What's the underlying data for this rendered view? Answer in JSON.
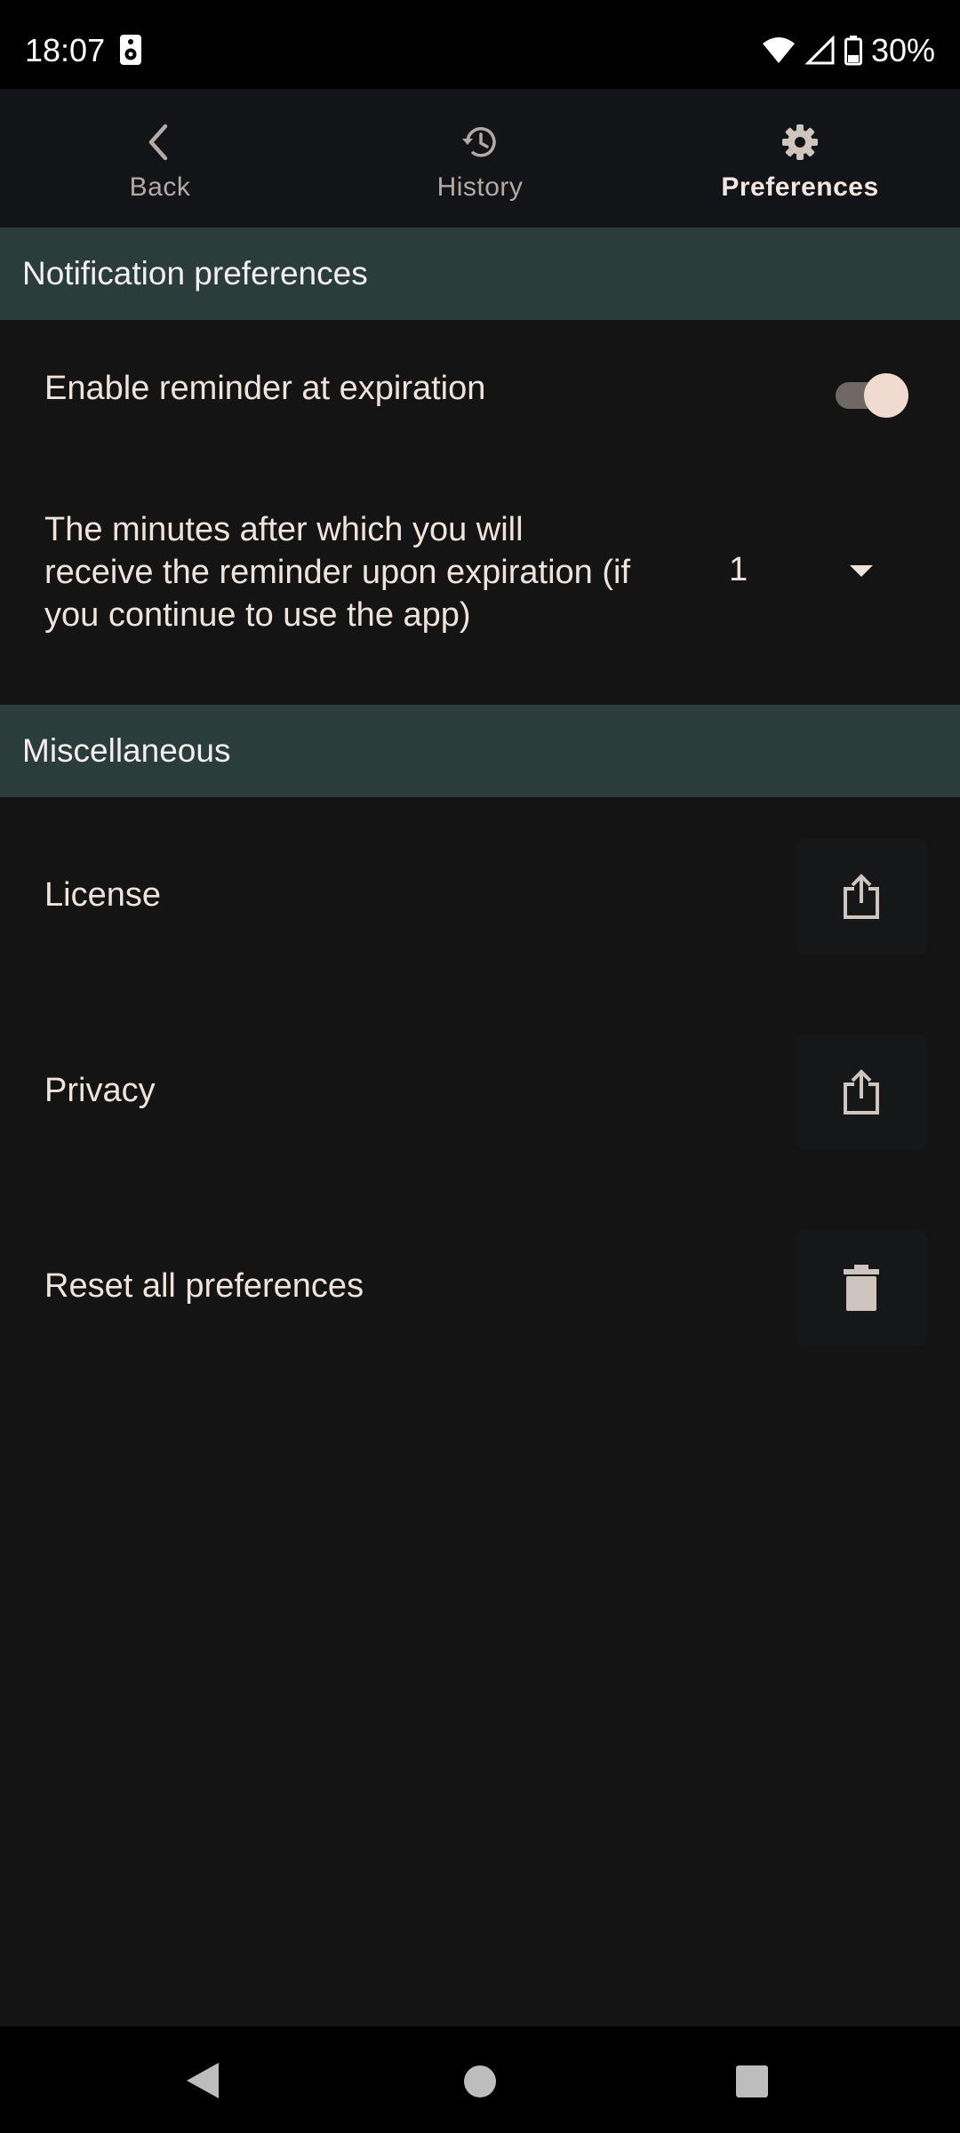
{
  "status_bar": {
    "time": "18:07",
    "battery": "30%",
    "icons": [
      "speaker-icon",
      "wifi-icon",
      "signal-icon",
      "battery-icon"
    ]
  },
  "nav": {
    "back": {
      "label": "Back",
      "icon": "chevron-left-icon"
    },
    "history": {
      "label": "History",
      "icon": "history-icon"
    },
    "preferences": {
      "label": "Preferences",
      "icon": "gear-icon",
      "active": true
    }
  },
  "sections": {
    "notification": {
      "title": "Notification preferences",
      "reminder_label": "Enable reminder at expiration",
      "reminder_enabled": true,
      "minutes_label_lines": [
        "The minutes after which you will",
        "receive the reminder upon expiration (if",
        "you continue to use the app)"
      ],
      "minutes_value": "1"
    },
    "misc": {
      "title": "Miscellaneous",
      "license_label": "License",
      "privacy_label": "Privacy",
      "reset_label": "Reset all preferences"
    }
  },
  "colors": {
    "background": "#141414",
    "section_header": "#2b3d3b",
    "accent_text": "#efe3dd",
    "toggle_thumb": "#f1dbd1"
  }
}
